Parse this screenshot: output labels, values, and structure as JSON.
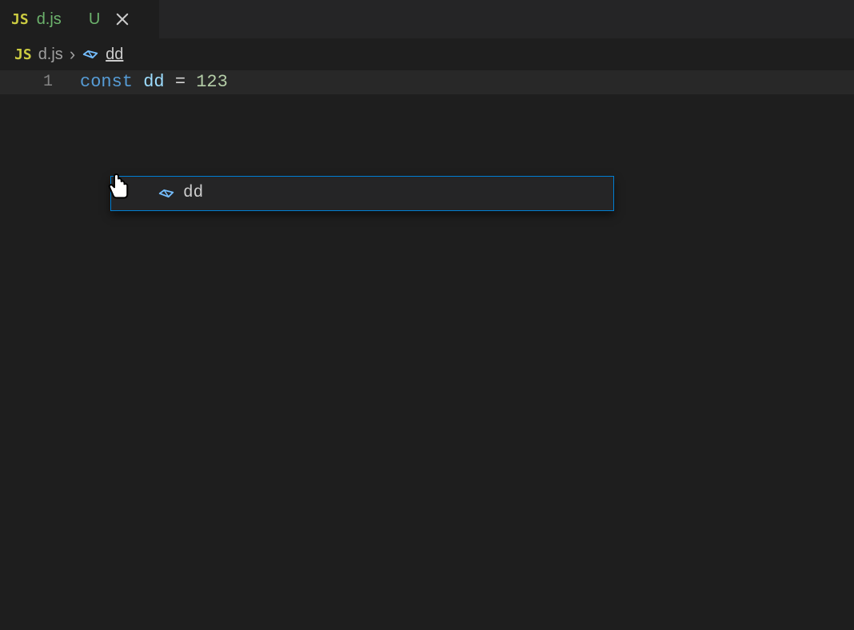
{
  "tab": {
    "filename": "d.js",
    "file_icon_label": "JS",
    "modified_badge": "U"
  },
  "breadcrumb": {
    "file_icon_label": "JS",
    "file": "d.js",
    "separator": "›",
    "symbol": "dd"
  },
  "editor": {
    "lines": [
      {
        "number": "1",
        "tokens": {
          "kw": "const",
          "ident": "dd",
          "eq": "=",
          "num": "123"
        }
      }
    ]
  },
  "dropdown": {
    "items": [
      {
        "label": "dd"
      }
    ]
  },
  "colors": {
    "accent": "#007fd4",
    "js_icon": "#cbcb41",
    "var_icon": "#75beff"
  }
}
